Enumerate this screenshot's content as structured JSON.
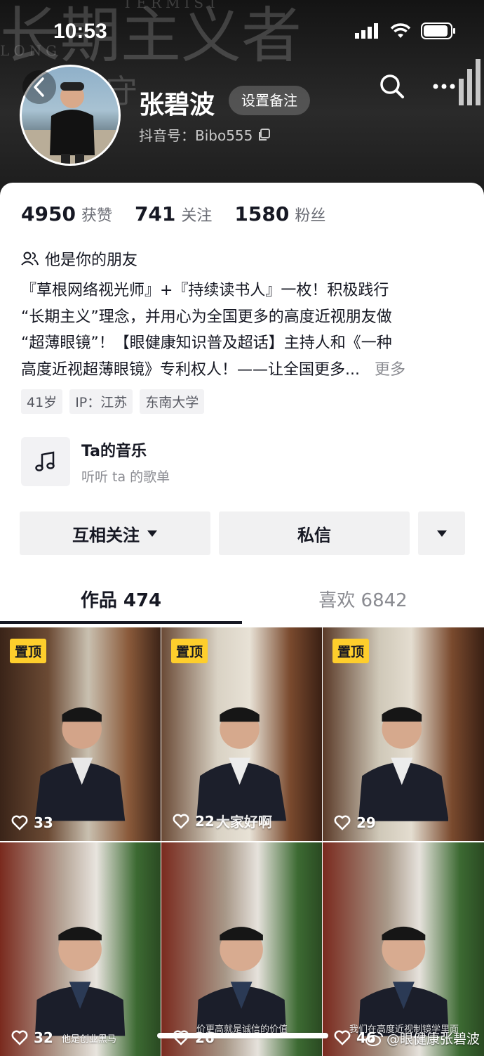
{
  "status": {
    "time": "10:53"
  },
  "header": {
    "bg_text_1": "长期主义者",
    "bg_text_2": "TERMIST",
    "bg_text_3": "LONG",
    "bg_text_4": "守",
    "name": "张碧波",
    "remark_label": "设置备注",
    "douyin_id": "抖音号：Bibo555"
  },
  "stats": [
    {
      "num": "4950",
      "label": "获赞"
    },
    {
      "num": "741",
      "label": "关注"
    },
    {
      "num": "1580",
      "label": "粉丝"
    }
  ],
  "friend_label": "他是你的朋友",
  "bio": {
    "lines": [
      "『草根网络视光师』+『持续读书人』一枚！积极践行",
      "“长期主义”理念，并用心为全国更多的高度近视朋友做",
      "“超薄眼镜”！【眼健康知识普及超话】主持人和《一种",
      "高度近视超薄眼镜》专利权人！——让全国更多..."
    ],
    "more": "更多"
  },
  "tags": [
    "41岁",
    "IP：江苏",
    "东南大学"
  ],
  "music": {
    "title": "Ta的音乐",
    "subtitle": "听听 ta 的歌单"
  },
  "actions": {
    "follow": "互相关注",
    "message": "私信"
  },
  "tabs": {
    "works": "作品 474",
    "likes": "喜欢 6842"
  },
  "videos": [
    {
      "pin": "置顶",
      "likes": "33",
      "caption": ""
    },
    {
      "pin": "置顶",
      "likes": "22",
      "caption": "大家好啊"
    },
    {
      "pin": "置顶",
      "likes": "29",
      "caption": ""
    },
    {
      "pin": "",
      "likes": "32",
      "caption": "他是创业黑马"
    },
    {
      "pin": "",
      "likes": "26",
      "caption": "价更高就是诚信的价值"
    },
    {
      "pin": "",
      "likes": "46",
      "caption": "我们在高度近视制镜学里面"
    }
  ],
  "watermark": "@眼健康张碧波",
  "colors": {
    "pin": "#fece2c",
    "text": "#161823",
    "muted": "#8a8b91"
  }
}
